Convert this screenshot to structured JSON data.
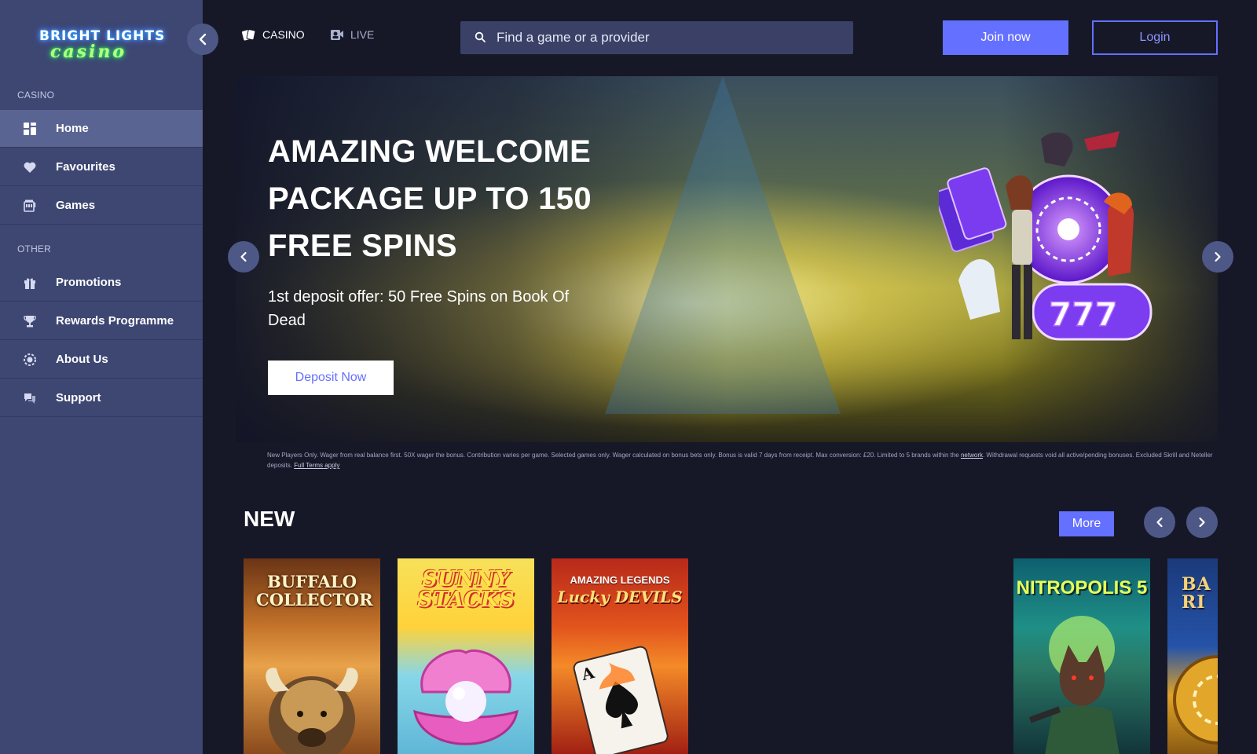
{
  "brand": {
    "line1": "BRIGHT LIGHTS",
    "line2": "casino"
  },
  "topnav": [
    {
      "label": "CASINO",
      "icon": "cards-icon"
    },
    {
      "label": "LIVE",
      "icon": "live-dealer-icon"
    }
  ],
  "search": {
    "placeholder": "Find a game or a provider"
  },
  "auth": {
    "join": "Join now",
    "login": "Login"
  },
  "sidebar": {
    "section_casino": "CASINO",
    "section_other": "OTHER",
    "casino_items": [
      {
        "label": "Home",
        "icon": "grid-icon",
        "active": true
      },
      {
        "label": "Favourites",
        "icon": "heart-icon"
      },
      {
        "label": "Games",
        "icon": "slot-machine-icon"
      }
    ],
    "other_items": [
      {
        "label": "Promotions",
        "icon": "gift-icon"
      },
      {
        "label": "Rewards Programme",
        "icon": "trophy-icon"
      },
      {
        "label": "About Us",
        "icon": "chip-icon"
      },
      {
        "label": "Support",
        "icon": "chat-icon"
      }
    ]
  },
  "hero": {
    "title": "AMAZING WELCOME PACKAGE UP TO 150 FREE SPINS",
    "subtitle": "1st deposit offer: 50 Free Spins on Book Of Dead",
    "cta": "Deposit Now"
  },
  "terms": {
    "text_before": "New Players Only. Wager from real balance first. 50X wager the bonus. Contribution varies per game. Selected games only. Wager calculated on bonus bets only. Bonus is valid 7 days from receipt. Max conversion: £20. Limited to 5 brands within the ",
    "network_link": "network",
    "text_after": ". Withdrawal requests void all active/pending bonuses. Excluded Skrill and Neteller deposits. ",
    "full_terms_link": "Full Terms apply"
  },
  "new_section": {
    "title": "NEW",
    "more": "More",
    "games": [
      {
        "name": "BUFFALO COLLECTOR"
      },
      {
        "name": "SUNNY STACKS"
      },
      {
        "name": "AMAZING LEGENDS",
        "name2": "Lucky DEVILS"
      },
      {
        "name": "NITROPOLIS 5"
      },
      {
        "name": "BA RI"
      }
    ]
  },
  "colors": {
    "accent": "#6470ff",
    "sidebar": "#3d4772",
    "background": "#161828",
    "active_item": "#5a6493"
  }
}
